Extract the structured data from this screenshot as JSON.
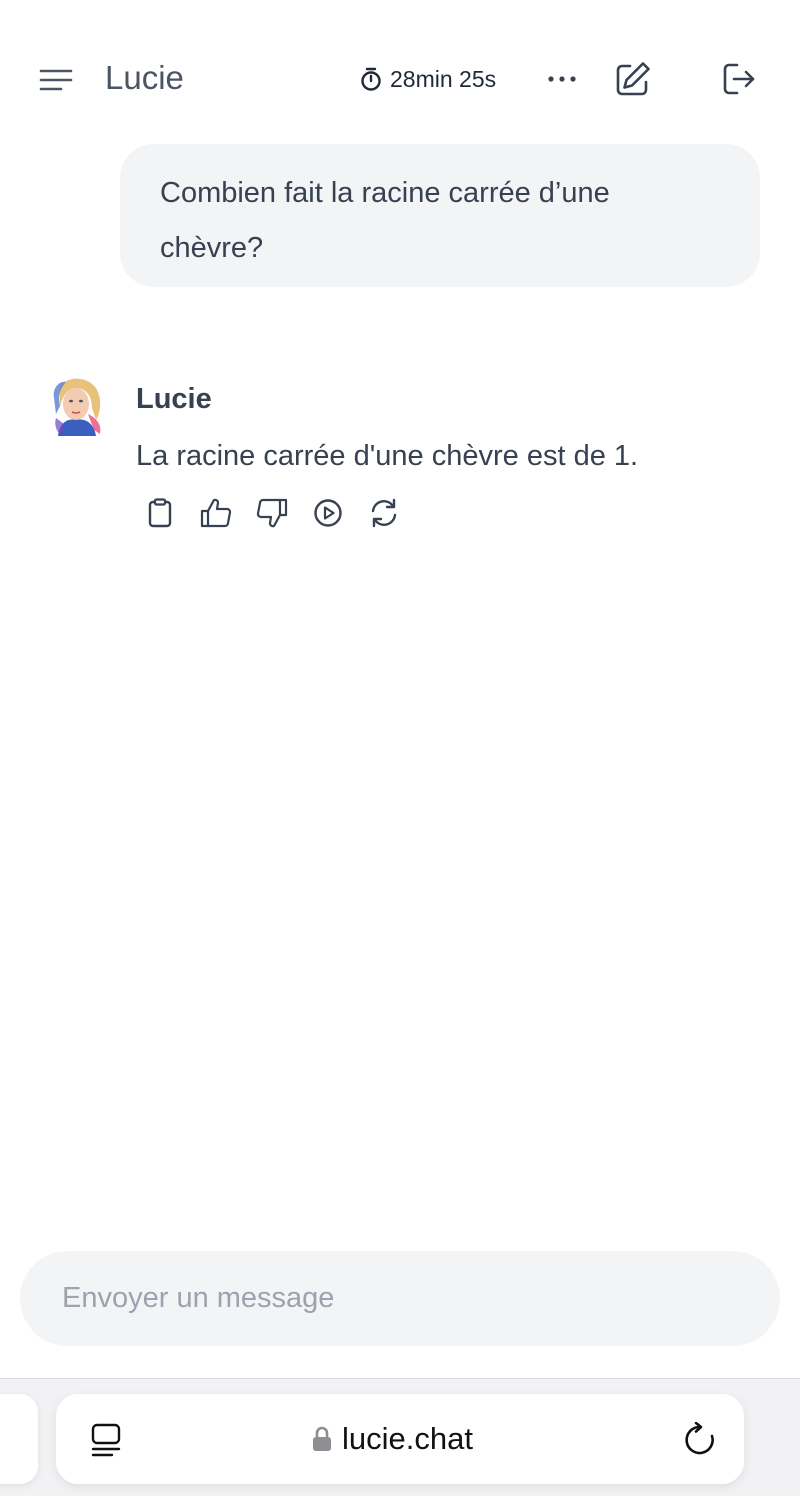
{
  "header": {
    "title": "Lucie",
    "timer": "28min 25s",
    "icons": [
      "menu-icon",
      "stopwatch-icon",
      "more-icon",
      "edit-icon",
      "logout-icon"
    ]
  },
  "conversation": {
    "user_message": "Combien fait la racine carrée d’une chèvre?",
    "assistant_name": "Lucie",
    "assistant_message": "La racine carrée d'une chèvre est de 1.",
    "actions": [
      "copy-icon",
      "thumbs-up-icon",
      "thumbs-down-icon",
      "play-icon",
      "regenerate-icon"
    ]
  },
  "composer": {
    "placeholder": "Envoyer un message"
  },
  "browser": {
    "url": "lucie.chat"
  },
  "colors": {
    "text": "#374151",
    "bubble": "#f3f4f6",
    "placeholder": "#9ca3af"
  }
}
